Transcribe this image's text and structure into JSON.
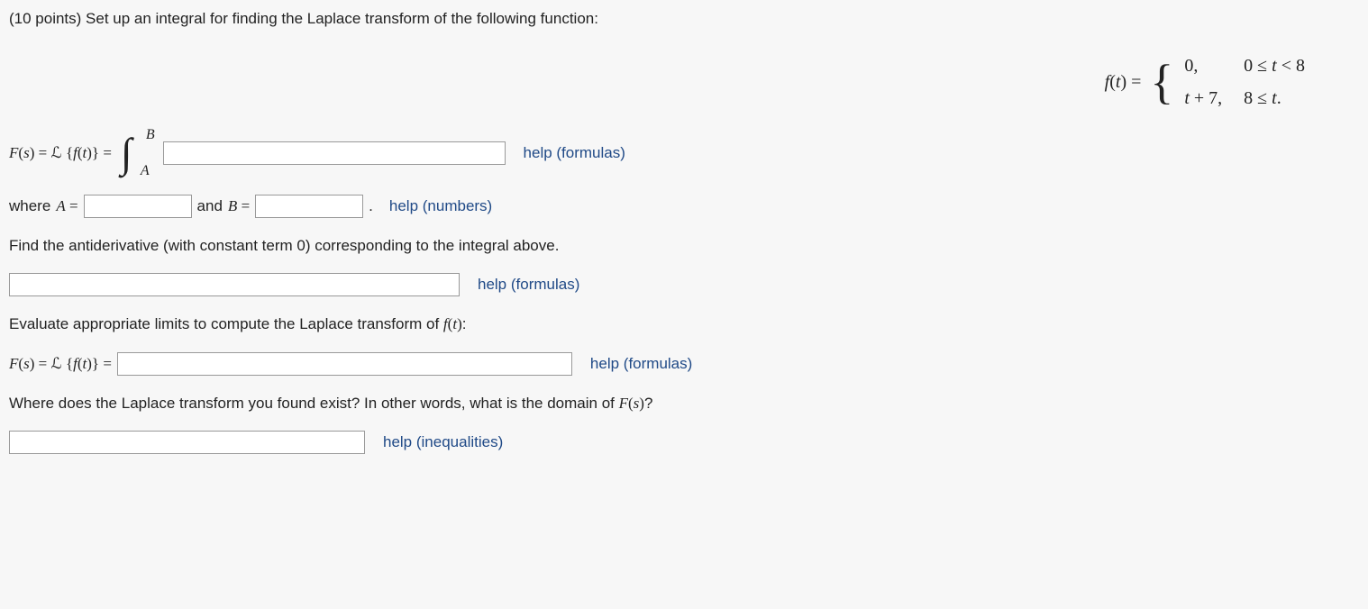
{
  "prompt": {
    "points_prefix": "(10 points) ",
    "text": "Set up an integral for finding the Laplace transform of the following function:"
  },
  "piecewise": {
    "lhs": "f(t) = ",
    "rows": [
      {
        "value": "0,",
        "cond": "0 ≤ t < 8"
      },
      {
        "value": "t + 7,",
        "cond": "8 ≤ t."
      }
    ]
  },
  "line1": {
    "lhs": "F(s) = ℒ {f(t)} = ",
    "int_upper": "B",
    "int_lower": "A",
    "help": "help (formulas)"
  },
  "line2": {
    "where": "where ",
    "A_eq": "A = ",
    "and": " and ",
    "B_eq": "B = ",
    "period": ".",
    "help": "help (numbers)"
  },
  "line3": {
    "text": "Find the antiderivative (with constant term 0) corresponding to the integral above.",
    "help": "help (formulas)"
  },
  "line4": {
    "text_a": "Evaluate appropriate limits to compute the Laplace transform of ",
    "ft": "f(t)",
    "text_b": ":",
    "lhs": "F(s) = ℒ {f(t)} = ",
    "help": "help (formulas)"
  },
  "line5": {
    "text_a": "Where does the Laplace transform you found exist? In other words, what is the domain of ",
    "Fs": "F(s)",
    "text_b": "?",
    "help": "help (inequalities)"
  }
}
